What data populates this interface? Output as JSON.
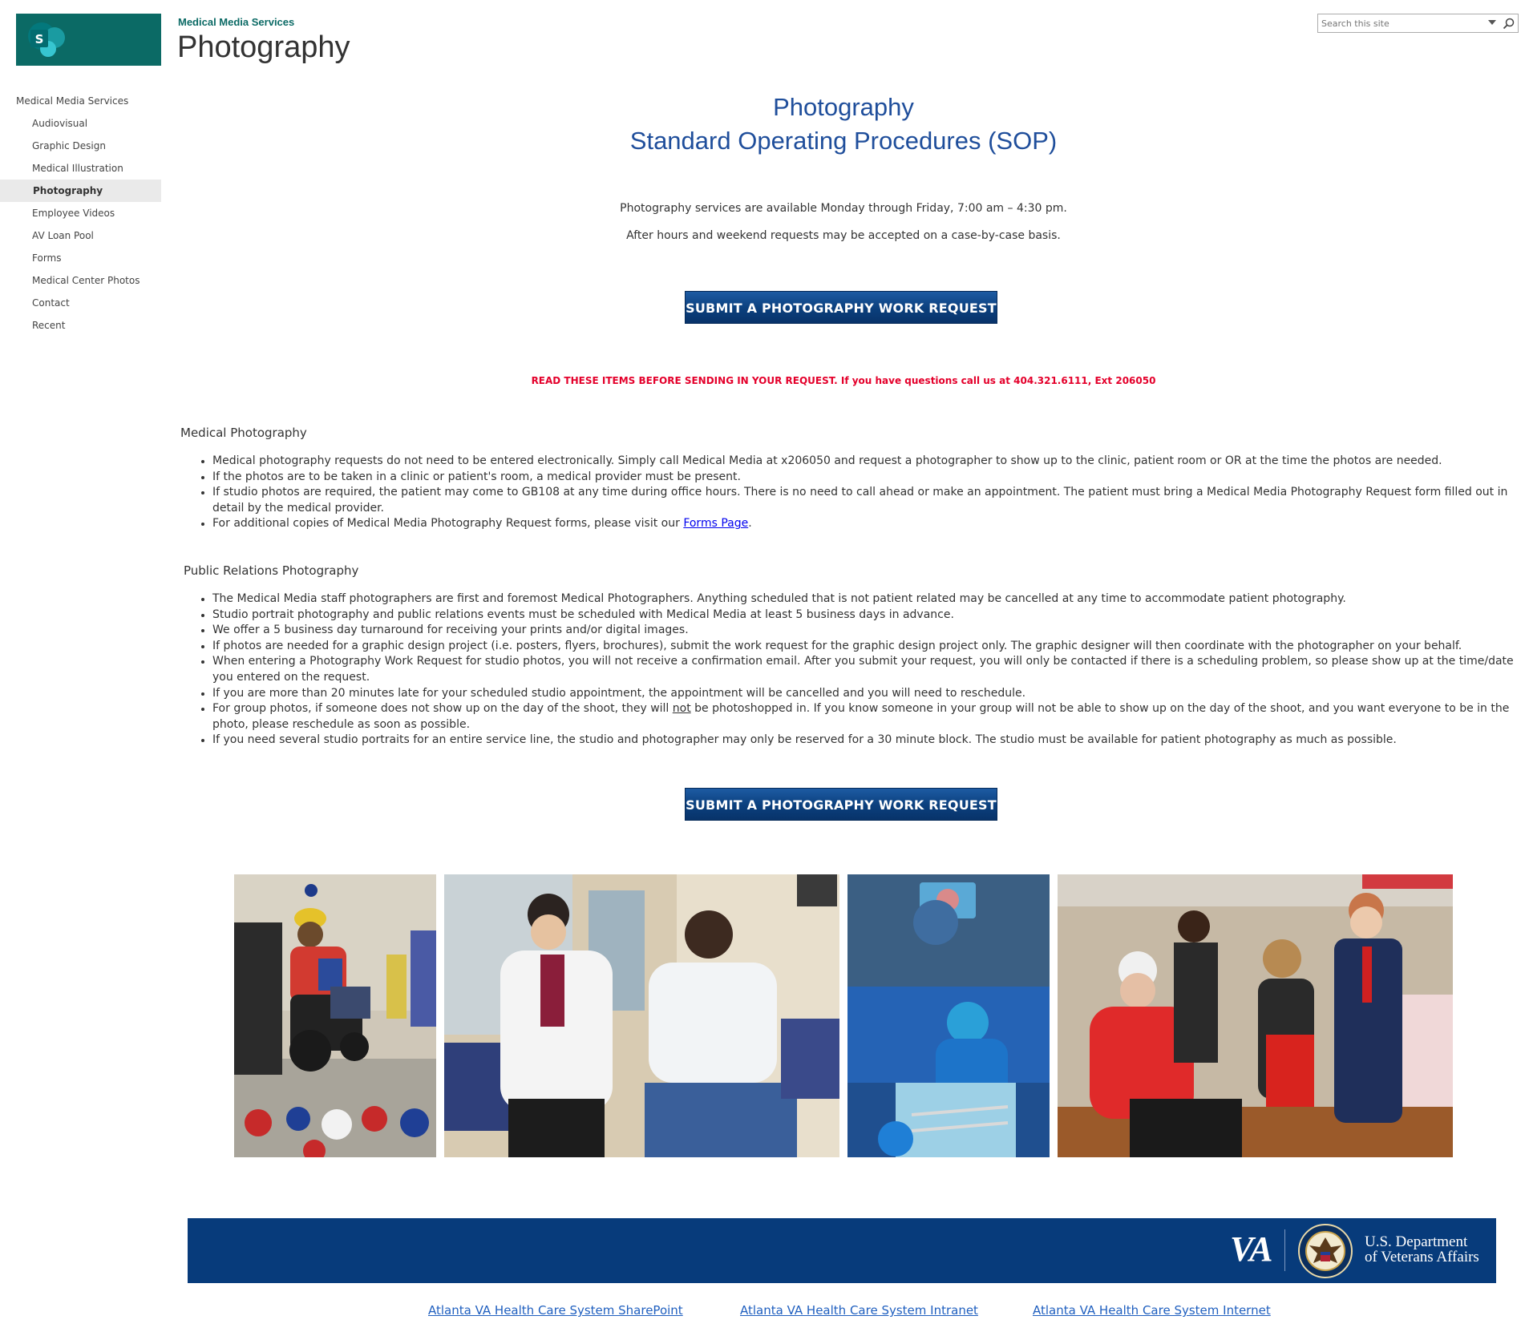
{
  "header": {
    "site_name": "Medical Media Services",
    "page_title": "Photography",
    "logo_letter": "S",
    "search_placeholder": "Search this site"
  },
  "nav": {
    "head": "Medical Media Services",
    "items": [
      {
        "label": "Audiovisual"
      },
      {
        "label": "Graphic Design"
      },
      {
        "label": "Medical Illustration"
      },
      {
        "label": "Photography",
        "selected": true
      },
      {
        "label": "Employee Videos"
      },
      {
        "label": "AV Loan Pool"
      },
      {
        "label": "Forms"
      },
      {
        "label": "Medical Center Photos"
      },
      {
        "label": "Contact"
      },
      {
        "label": "Recent"
      }
    ]
  },
  "content": {
    "title_line1": "Photography",
    "title_line2": "Standard Operating Procedures (SOP)",
    "hours_line1": "Photography services are available Monday through Friday, 7:00 am – 4:30 pm.",
    "hours_line2": "After hours and weekend requests may be accepted on a case-by-case basis.",
    "submit_label": "SUBMIT A PHOTOGRAPHY WORK REQUEST",
    "warning": "READ THESE ITEMS BEFORE SENDING IN YOUR REQUEST. If you have questions call us at 404.321.6111, Ext 206050",
    "medical": {
      "heading": "Medical Photography",
      "items": [
        "Medical photography requests do not need to be entered electronically. Simply call Medical Media at x206050 and request a photographer to show up to the clinic, patient room or OR at the time the photos are needed.",
        "If the photos are to be taken in a clinic or patient's room, a medical provider must be present.",
        "If studio photos are required, the patient may come to GB108 at any time during office hours. There is no need to call ahead or make an appointment. The patient must bring a Medical Media Photography Request form filled out in detail by the medical provider."
      ],
      "forms_prefix": "For additional copies of Medical Media Photography Request forms, please visit our ",
      "forms_link": "Forms Page",
      "forms_suffix": "."
    },
    "pr": {
      "heading": "Public Relations Photography",
      "items": [
        "The Medical Media staff photographers are first and foremost Medical Photographers. Anything scheduled that is not patient related may be cancelled at any time to accommodate patient photography.",
        "Studio portrait photography and public relations events must be scheduled with Medical Media at least 5 business days in advance.",
        "We offer a 5 business day turnaround for receiving your prints and/or digital images.",
        "If photos are needed for a graphic design project (i.e. posters, flyers, brochures), submit the work request for the graphic design project only. The graphic designer will then coordinate with the photographer on your behalf.",
        "When entering a Photography Work Request for studio photos, you will not receive a confirmation email. After you submit your request, you will only be contacted if there is a scheduling problem, so please show up at the time/date you entered on the request.",
        "If you are more than 20 minutes late for your scheduled studio appointment, the appointment will be cancelled and you will need to reschedule."
      ],
      "group_prefix": "For group photos, if someone does not show up on the day of the shoot, they will ",
      "group_emph": "not",
      "group_suffix": " be photoshopped in. If you know someone in your group will not be able to show up on the day of the shoot, and you want everyone to be in the photo, please reschedule as soon as possible.",
      "last_item": "If you need several studio portraits for an entire service line, the studio and photographer may only be reserved for a 30 minute block. The studio must be available for patient photography as much as possible."
    }
  },
  "footer": {
    "va_mark": "VA",
    "dept_line1": "U.S. Department",
    "dept_line2": "of Veterans Affairs",
    "links": [
      "Atlanta VA Health Care System SharePoint",
      "Atlanta VA Health Care System Intranet",
      "Atlanta VA Health Care System Internet "
    ]
  },
  "colors": {
    "brand_teal": "#0b6a65",
    "title_blue": "#1f4e9b",
    "warning_red": "#e4002b",
    "banner_navy": "#073b7b"
  }
}
